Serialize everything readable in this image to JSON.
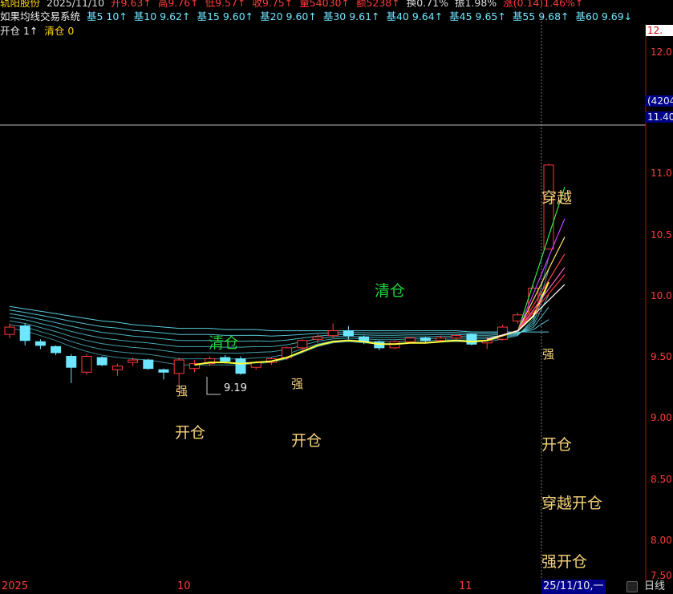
{
  "header": {
    "stock_name": "轨阳股份",
    "date": "2025/11/10",
    "open": "开9.63↑",
    "high": "高9.76↑",
    "low": "低9.57↑",
    "close": "收9.75↑",
    "volume": "量54030↑",
    "amount": "额5238↑",
    "turnover": "换0.71%",
    "amplitude": "振1.98%",
    "change": "涨(0.14)1.46%↑"
  },
  "indicator": {
    "name": "如果均线交易系统",
    "values": [
      "基5 10↑",
      "基10 9.62↑",
      "基15 9.60↑",
      "基20 9.60↑",
      "基30 9.61↑",
      "基40 9.64↑",
      "基45 9.65↑",
      "基55 9.68↑",
      "基60 9.69↓"
    ]
  },
  "signals_line": {
    "open_label": "开仓 1↑",
    "clear_label": "清仓 0"
  },
  "price_axis": {
    "top_box": "12.",
    "labels": [
      "12.0",
      "11.4",
      "11.0",
      "10.5",
      "10.0",
      "9.50",
      "9.00",
      "8.50",
      "8.00",
      "7.50"
    ],
    "blue_box_1": "(4204",
    "blue_box_2": "11.40"
  },
  "x_axis": {
    "labels": [
      "2025",
      "10",
      "11"
    ]
  },
  "annotations": {
    "low_price": "9.19",
    "chuanyue": "穿越",
    "qingcang": "清仓",
    "kaicang": "开仓",
    "qiang": "强",
    "chuanyue_kaicang": "穿越开仓",
    "qiang_kaicang": "强开仓"
  },
  "footer": {
    "date_box": "25/11/10,一",
    "period_tab": "日线"
  },
  "colors": {
    "up": "#ff3b3b",
    "down": "#6fe6ff",
    "signal_yellow": "#f6d27a",
    "signal_green": "#1fd43a",
    "ma_band": "#5fd8e8",
    "ma_fast": "#ffff40"
  },
  "chart_data": {
    "type": "candlestick",
    "candles": [
      {
        "o": 9.67,
        "c": 9.73,
        "h": 9.76,
        "l": 9.64
      },
      {
        "o": 9.74,
        "c": 9.62,
        "h": 9.76,
        "l": 9.58
      },
      {
        "o": 9.61,
        "c": 9.58,
        "h": 9.63,
        "l": 9.55
      },
      {
        "o": 9.57,
        "c": 9.52,
        "h": 9.58,
        "l": 9.5
      },
      {
        "o": 9.49,
        "c": 9.4,
        "h": 9.51,
        "l": 9.27
      },
      {
        "o": 9.36,
        "c": 9.49,
        "h": 9.51,
        "l": 9.34
      },
      {
        "o": 9.48,
        "c": 9.42,
        "h": 9.49,
        "l": 9.41
      },
      {
        "o": 9.38,
        "c": 9.41,
        "h": 9.43,
        "l": 9.33
      },
      {
        "o": 9.44,
        "c": 9.46,
        "h": 9.48,
        "l": 9.41
      },
      {
        "o": 9.46,
        "c": 9.39,
        "h": 9.47,
        "l": 9.38
      },
      {
        "o": 9.38,
        "c": 9.36,
        "h": 9.39,
        "l": 9.3
      },
      {
        "o": 9.35,
        "c": 9.46,
        "h": 9.48,
        "l": 9.19
      },
      {
        "o": 9.39,
        "c": 9.43,
        "h": 9.46,
        "l": 9.36
      },
      {
        "o": 9.43,
        "c": 9.47,
        "h": 9.49,
        "l": 9.41
      },
      {
        "o": 9.48,
        "c": 9.45,
        "h": 9.5,
        "l": 9.43
      },
      {
        "o": 9.47,
        "c": 9.35,
        "h": 9.49,
        "l": 9.34
      },
      {
        "o": 9.4,
        "c": 9.44,
        "h": 9.45,
        "l": 9.38
      },
      {
        "o": 9.44,
        "c": 9.47,
        "h": 9.48,
        "l": 9.42
      },
      {
        "o": 9.48,
        "c": 9.56,
        "h": 9.57,
        "l": 9.46
      },
      {
        "o": 9.56,
        "c": 9.62,
        "h": 9.63,
        "l": 9.54
      },
      {
        "o": 9.63,
        "c": 9.65,
        "h": 9.67,
        "l": 9.6
      },
      {
        "o": 9.66,
        "c": 9.7,
        "h": 9.76,
        "l": 9.64
      },
      {
        "o": 9.7,
        "c": 9.66,
        "h": 9.74,
        "l": 9.63
      },
      {
        "o": 9.65,
        "c": 9.61,
        "h": 9.66,
        "l": 9.59
      },
      {
        "o": 9.61,
        "c": 9.56,
        "h": 9.62,
        "l": 9.54
      },
      {
        "o": 9.56,
        "c": 9.61,
        "h": 9.62,
        "l": 9.55
      },
      {
        "o": 9.61,
        "c": 9.64,
        "h": 9.65,
        "l": 9.6
      },
      {
        "o": 9.64,
        "c": 9.62,
        "h": 9.65,
        "l": 9.6
      },
      {
        "o": 9.62,
        "c": 9.64,
        "h": 9.66,
        "l": 9.61
      },
      {
        "o": 9.64,
        "c": 9.66,
        "h": 9.67,
        "l": 9.63
      },
      {
        "o": 9.67,
        "c": 9.59,
        "h": 9.68,
        "l": 9.58
      },
      {
        "o": 9.6,
        "c": 9.62,
        "h": 9.65,
        "l": 9.55
      },
      {
        "o": 9.63,
        "c": 9.73,
        "h": 9.75,
        "l": 9.62
      },
      {
        "o": 9.78,
        "c": 9.83,
        "h": 9.85,
        "l": 9.76
      },
      {
        "o": 9.84,
        "c": 10.05,
        "h": 10.07,
        "l": 9.83
      },
      {
        "o": 10.37,
        "c": 11.06,
        "h": 11.07,
        "l": 10.37
      }
    ],
    "ma_band_top": [
      9.9,
      9.88,
      9.86,
      9.84,
      9.82,
      9.8,
      9.78,
      9.77,
      9.75,
      9.74,
      9.73,
      9.72,
      9.72,
      9.72,
      9.71,
      9.71,
      9.71,
      9.7,
      9.7,
      9.7,
      9.7,
      9.7,
      9.7,
      9.7,
      9.7,
      9.7,
      9.7,
      9.7,
      9.7,
      9.7,
      9.69,
      9.69,
      9.69,
      9.69,
      9.69,
      9.69
    ],
    "ma_band_bottom": [
      9.72,
      9.7,
      9.66,
      9.62,
      9.57,
      9.53,
      9.5,
      9.48,
      9.47,
      9.46,
      9.44,
      9.42,
      9.42,
      9.42,
      9.42,
      9.42,
      9.43,
      9.44,
      9.47,
      9.52,
      9.57,
      9.6,
      9.61,
      9.6,
      9.59,
      9.59,
      9.6,
      9.6,
      9.61,
      9.61,
      9.61,
      9.61,
      9.63,
      9.66,
      9.8,
      10.3
    ],
    "ma_fast": [
      null,
      null,
      null,
      null,
      null,
      null,
      null,
      null,
      null,
      null,
      null,
      null,
      9.42,
      9.44,
      9.44,
      9.43,
      9.44,
      9.45,
      9.48,
      9.53,
      9.58,
      9.61,
      9.62,
      9.61,
      9.59,
      9.59,
      9.6,
      9.6,
      9.61,
      9.62,
      9.61,
      9.62,
      9.66,
      9.7,
      9.82,
      10.1
    ]
  }
}
